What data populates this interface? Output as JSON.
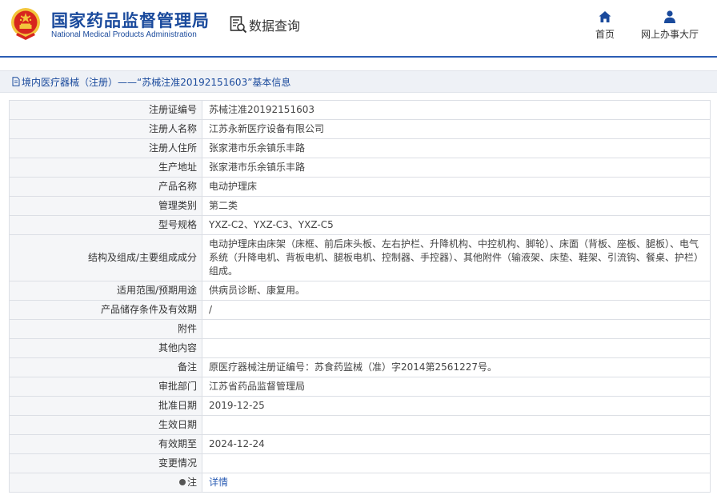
{
  "header": {
    "brand_cn": "国家药品监督管理局",
    "brand_en": "National Medical Products Administration",
    "query_label": "数据查询",
    "nav": [
      {
        "label": "首页",
        "icon": "home-icon"
      },
      {
        "label": "网上办事大厅",
        "icon": "user-icon"
      }
    ]
  },
  "breadcrumb": {
    "text": "境内医疗器械（注册）——“苏械注准20192151603”基本信息"
  },
  "colors": {
    "brand": "#1a4a9c",
    "emblem_red": "#d7261e",
    "emblem_gold": "#f3c63c",
    "link": "#2b5db4"
  },
  "rows": [
    {
      "key": "注册证编号",
      "value": "苏械注准20192151603"
    },
    {
      "key": "注册人名称",
      "value": "江苏永新医疗设备有限公司"
    },
    {
      "key": "注册人住所",
      "value": "张家港市乐余镇乐丰路"
    },
    {
      "key": "生产地址",
      "value": "张家港市乐余镇乐丰路"
    },
    {
      "key": "产品名称",
      "value": "电动护理床"
    },
    {
      "key": "管理类别",
      "value": "第二类"
    },
    {
      "key": "型号规格",
      "value": "YXZ-C2、YXZ-C3、YXZ-C5"
    },
    {
      "key": "结构及组成/主要组成成分",
      "value": "电动护理床由床架（床框、前后床头板、左右护栏、升降机构、中控机构、脚轮）、床面（背板、座板、腿板）、电气系统（升降电机、背板电机、腿板电机、控制器、手控器）、其他附件（输液架、床垫、鞋架、引流钩、餐桌、护栏）组成。"
    },
    {
      "key": "适用范围/预期用途",
      "value": "供病员诊断、康复用。"
    },
    {
      "key": "产品储存条件及有效期",
      "value": "/"
    },
    {
      "key": "附件",
      "value": ""
    },
    {
      "key": "其他内容",
      "value": ""
    },
    {
      "key": "备注",
      "value": "原医疗器械注册证编号：苏食药监械（准）字2014第2561227号。"
    },
    {
      "key": "审批部门",
      "value": "江苏省药品监督管理局"
    },
    {
      "key": "批准日期",
      "value": "2019-12-25"
    },
    {
      "key": "生效日期",
      "value": ""
    },
    {
      "key": "有效期至",
      "value": "2024-12-24"
    },
    {
      "key": "变更情况",
      "value": ""
    }
  ],
  "note_row": {
    "key": "注",
    "link": "详情"
  }
}
